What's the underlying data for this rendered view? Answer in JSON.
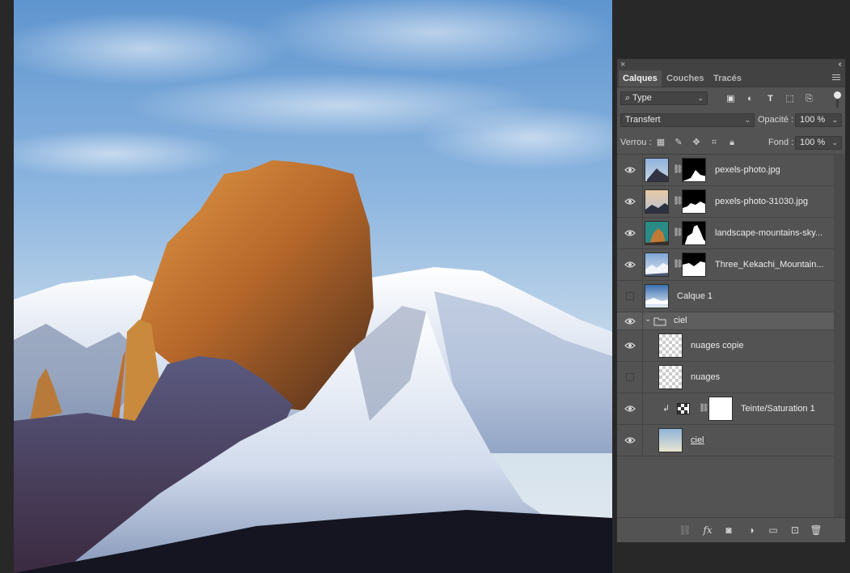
{
  "panel": {
    "close_glyph": "×",
    "collapse_glyph": "‹‹",
    "tabs": [
      {
        "label": "Calques",
        "active": true
      },
      {
        "label": "Couches",
        "active": false
      },
      {
        "label": "Tracés",
        "active": false
      }
    ],
    "filter": {
      "kind_label": "Type",
      "icons": [
        "image-filter-icon",
        "adjustment-filter-icon",
        "type-filter-icon",
        "shape-filter-icon",
        "smart-object-filter-icon"
      ]
    },
    "blend_mode": "Transfert",
    "opacity_label": "Opacité :",
    "opacity_value": "100 %",
    "lock_label": "Verrou :",
    "fill_label": "Fond :",
    "fill_value": "100 %",
    "layers": [
      {
        "name": "pexels-photo.jpg",
        "visible": true,
        "has_mask": true
      },
      {
        "name": "pexels-photo-31030.jpg",
        "visible": true,
        "has_mask": true
      },
      {
        "name": "landscape-mountains-sky...",
        "visible": true,
        "has_mask": true
      },
      {
        "name": "Three_Kekachi_Mountain...",
        "visible": true,
        "has_mask": true
      },
      {
        "name": "Calque 1",
        "visible": false,
        "has_mask": false
      },
      {
        "name": "ciel",
        "visible": true,
        "is_group": true,
        "expanded": true
      },
      {
        "name": "nuages copie",
        "visible": true,
        "in_group": true
      },
      {
        "name": "nuages",
        "visible": false,
        "in_group": true
      },
      {
        "name": "Teinte/Saturation 1",
        "visible": true,
        "in_group": true,
        "clipped": true,
        "adjustment": true
      },
      {
        "name": "ciel",
        "visible": true,
        "in_group": true
      }
    ],
    "footer_icons": [
      "link-layers-icon",
      "fx-icon",
      "add-mask-icon",
      "new-adjustment-icon",
      "new-group-icon",
      "new-layer-icon",
      "trash-icon"
    ]
  },
  "colors": {
    "panel_bg": "#535353",
    "tab_bar_bg": "#424242",
    "app_bg": "#282828",
    "selected_group_bg": "#5e5e5e"
  }
}
